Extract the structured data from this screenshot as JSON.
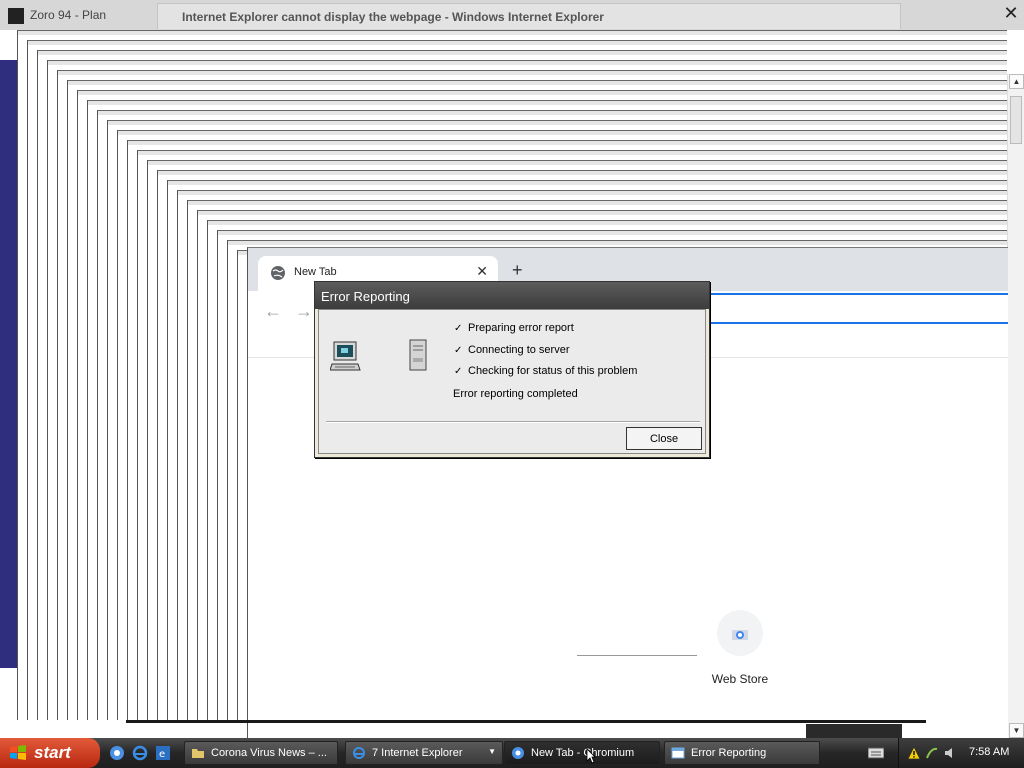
{
  "background_window": {
    "left_title": "Zoro 94 - Plan",
    "ie_title": "Internet Explorer cannot display the webpage - Windows Internet Explorer",
    "close_glyph": "✕"
  },
  "chromium": {
    "tab_title": "New Tab",
    "tab_close_glyph": "✕",
    "new_tab_glyph": "+",
    "back_glyph": "←",
    "forward_glyph": "→",
    "shortcut_label": "Web Store"
  },
  "dialog": {
    "title": "Error Reporting",
    "steps": [
      {
        "check": "✓",
        "label": "Preparing error report"
      },
      {
        "check": "✓",
        "label": "Connecting to server"
      },
      {
        "check": "✓",
        "label": "Checking for status of this problem"
      }
    ],
    "status": "Error reporting completed",
    "close_label": "Close"
  },
  "taskbar": {
    "start_label": "start",
    "tasks": [
      {
        "label": "Corona Virus News – ...",
        "icon": "folder-icon"
      },
      {
        "label": "7 Internet Explorer",
        "icon": "ie-icon"
      },
      {
        "label": "New Tab - Chromium",
        "icon": "chromium-icon"
      },
      {
        "label": "Error Reporting",
        "icon": "window-icon"
      }
    ],
    "clock": "7:58 AM"
  },
  "colors": {
    "dialog_title_bg": "#4a4a4a",
    "omnibox_focus": "#1a73e8",
    "start_button": "#c9381c",
    "desktop": "#2e2d7e"
  }
}
